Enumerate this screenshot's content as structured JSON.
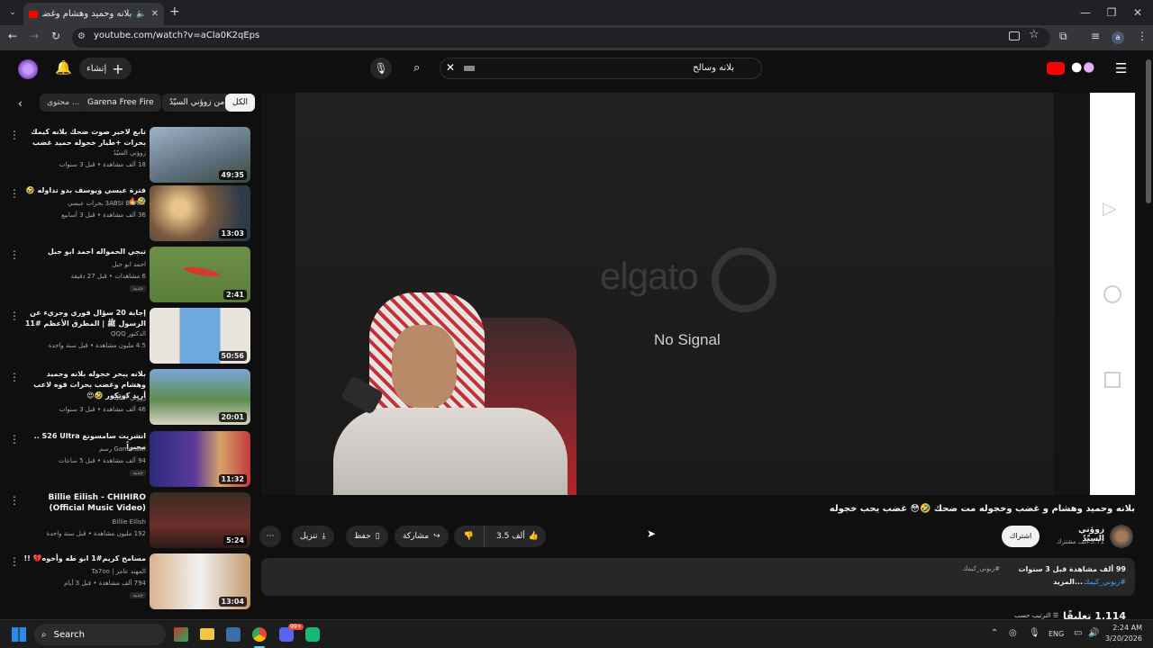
{
  "browser": {
    "tab_title": "بلانه وحميد وهشام وغضب",
    "url": "youtube.com/watch?v=aCla0K2qEps"
  },
  "youtube": {
    "create_label": "إنشاء",
    "search_query": "بلانه وسالح",
    "avatar_letter": "a",
    "chips": [
      "الكل",
      "من زوؤني السيّدٌ",
      "Garena Free Fire",
      "محتوى ..."
    ]
  },
  "recommendations": [
    {
      "title": "تابع لاخير صوت ضحك بلانه كيمك بحرات +طيار خجوله حميد غضب كوتكور بحر ...",
      "channel": "زوؤني السيّدٌ",
      "meta": "18 ألف مشاهدة • قبل 3 سنوات",
      "duration": "49:35",
      "badge": ""
    },
    {
      "title": "فترة عبسي ويوسف بدو تداوله 🤣🤣🔥",
      "channel": "3ABSI BARAT بحرات عبسي",
      "meta": "36 ألف مشاهدة • قبل 3 أسابيع",
      "duration": "13:03",
      "badge": ""
    },
    {
      "title": "تبجي الحمواله احمد ابو جبل",
      "channel": "احمد ابو جبل",
      "meta": "6 مشاهدات • قبل 27 دقيقة",
      "duration": "2:41",
      "badge": "جديد"
    },
    {
      "title": "إجابة 20 سؤال فوري وجريء عن الرسول ﷺ | المطرق الأعظم #11",
      "channel": "الدكتور QQQ",
      "meta": "4.5 مليون مشاهدة • قبل سنة واحدة",
      "duration": "50:56",
      "badge": ""
    },
    {
      "title": "بلانه يبحر خجوله بلانه وحميد وهشام وغضب بحرات قوه لاعب أريد كوتكور 🤣😍",
      "channel": "زوؤني السيّدٌ",
      "meta": "46 ألف مشاهدة • قبل 3 سنوات",
      "duration": "20:01",
      "badge": ""
    },
    {
      "title": "انشريت سامسونغ S26 Ultra .. مجبراً",
      "channel": "Gamerawi رسم",
      "meta": "94 ألف مشاهدة • قبل 5 ساعات",
      "duration": "11:32",
      "badge": "جديد"
    },
    {
      "title": "Billie Eilish - CHIHIRO (Official Music Video)",
      "channel": "Billie Eilish",
      "meta": "192 مليون مشاهدة • قبل سنة واحدة",
      "duration": "5:24",
      "badge": ""
    },
    {
      "title": "مسامح كريم#1 ابو طه وأخوه💔 !!",
      "channel": "المهند عامر | Ta7oo",
      "meta": "794 ألف مشاهدة • قبل 3 أيام",
      "duration": "13:04",
      "badge": "جديد"
    }
  ],
  "player": {
    "brand": "elgato",
    "status": "No Signal"
  },
  "video": {
    "title": "بلانه وحميد وهشام و غضب وخجوله مت ضحك 🤣😳 غضب يحب خجوله",
    "channel": "زوؤني السيّدٌ",
    "subscribers": "5.71 ألف مشترك",
    "subscribe_label": "اشتراك",
    "likes": "3.5 ألف",
    "share_label": "مشاركة",
    "save_label": "حفظ",
    "download_label": "تنزيل",
    "desc_stats": "99 ألف مشاهدة قبل 3 سنوات",
    "desc_tag": "#زيوني_كيمك",
    "desc_more": "...المزيد",
    "desc_hashtag": "#زيوني_كيمك",
    "comments_count": "1.114 تعليقًا",
    "sort_label": "الترتيب حسب"
  },
  "taskbar": {
    "search_label": "Search",
    "lang": "ENG",
    "time": "2:24 AM",
    "date": "3/20/2026",
    "badge": "99+"
  },
  "colors": {
    "yt_red": "#ff0000",
    "link_blue": "#3ea6ff",
    "chip_bg": "#272727"
  }
}
